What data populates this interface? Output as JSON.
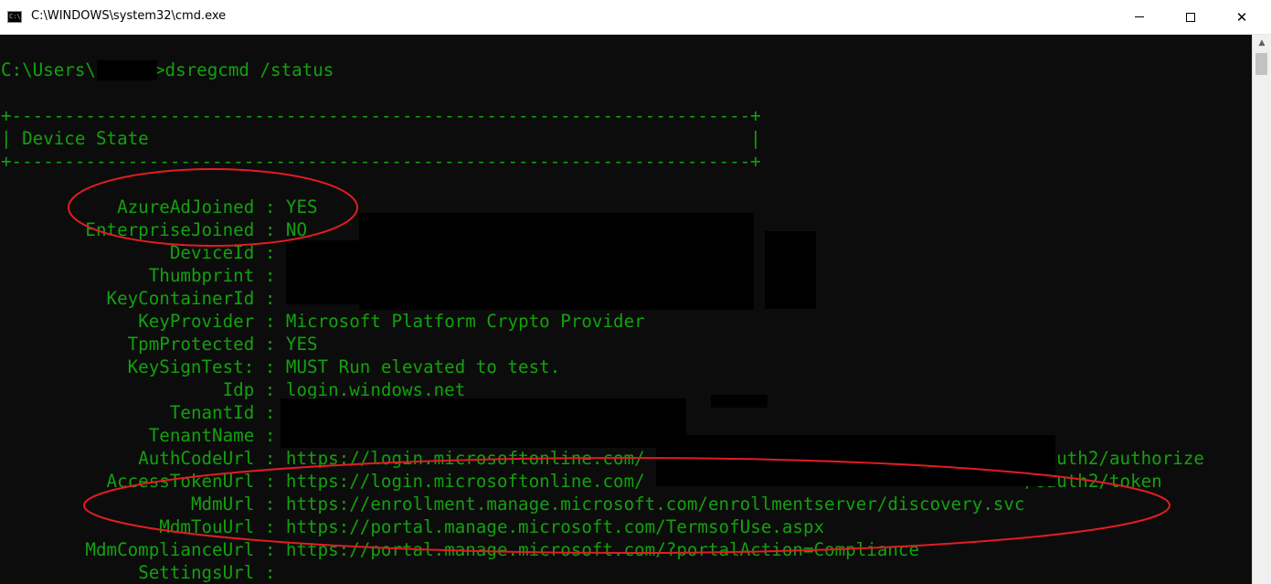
{
  "window": {
    "title": "C:\\WINDOWS\\system32\\cmd.exe",
    "icon": "console-icon",
    "icon_text": "C:\\",
    "buttons": {
      "minimize": "minimize-icon",
      "maximize": "maximize-icon",
      "close": "close-icon"
    },
    "close_glyph": "✕"
  },
  "colors": {
    "console_bg": "#0c0c0c",
    "console_text": "#13a10e",
    "annotation": "#e31c23"
  },
  "console": {
    "prompt_prefix": "C:\\Users\\",
    "prompt_command": ">dsregcmd /status",
    "border_top": "+----------------------------------------------------------------------+",
    "header": "| Device State                                                         |",
    "border_bottom": "+----------------------------------------------------------------------+",
    "rows": [
      {
        "key": "AzureAdJoined",
        "sep": " : ",
        "value": "YES"
      },
      {
        "key": "EnterpriseJoined",
        "sep": " : ",
        "value": "NO"
      },
      {
        "key": "DeviceId",
        "sep": " : ",
        "value": ""
      },
      {
        "key": "Thumbprint",
        "sep": " : ",
        "value": ""
      },
      {
        "key": "KeyContainerId",
        "sep": " : ",
        "value": ""
      },
      {
        "key": "KeyProvider",
        "sep": " : ",
        "value": "Microsoft Platform Crypto Provider"
      },
      {
        "key": "TpmProtected",
        "sep": " : ",
        "value": "YES"
      },
      {
        "key": "KeySignTest:",
        "sep": " : ",
        "value": "MUST Run elevated to test."
      },
      {
        "key": "Idp",
        "sep": " : ",
        "value": "login.windows.net"
      },
      {
        "key": "TenantId",
        "sep": " : ",
        "value": ""
      },
      {
        "key": "TenantName",
        "sep": " : ",
        "value": ""
      },
      {
        "key": "AuthCodeUrl",
        "sep": " : ",
        "value": "https://login.microsoftonline.com/                                    /oauth2/authorize"
      },
      {
        "key": "AccessTokenUrl",
        "sep": " : ",
        "value": "https://login.microsoftonline.com/                                    /oauth2/token"
      },
      {
        "key": "MdmUrl",
        "sep": " : ",
        "value": "https://enrollment.manage.microsoft.com/enrollmentserver/discovery.svc"
      },
      {
        "key": "MdmTouUrl",
        "sep": " : ",
        "value": "https://portal.manage.microsoft.com/TermsofUse.aspx"
      },
      {
        "key": "MdmComplianceUrl",
        "sep": " : ",
        "value": "https://portal.manage.microsoft.com/?portalAction=Compliance"
      },
      {
        "key": "SettingsUrl",
        "sep": " : ",
        "value": ""
      }
    ]
  }
}
